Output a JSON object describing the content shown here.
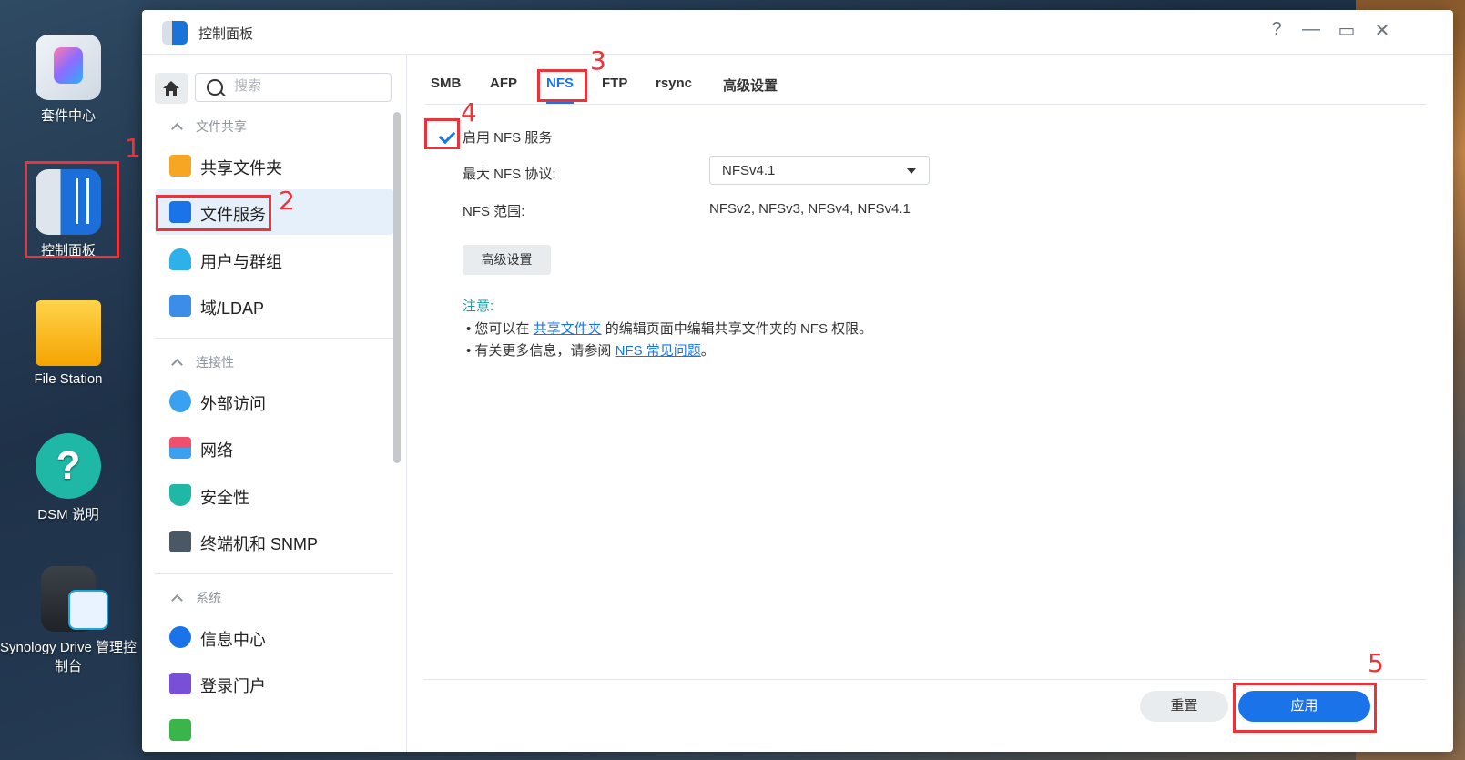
{
  "desktop": {
    "icons": [
      {
        "label": "套件中心"
      },
      {
        "label": "控制面板"
      },
      {
        "label": "File Station"
      },
      {
        "label": "DSM 说明"
      },
      {
        "label": "Synology Drive 管理控制台"
      }
    ]
  },
  "annotations": [
    "1",
    "2",
    "3",
    "4",
    "5"
  ],
  "window": {
    "title": "控制面板",
    "help_glyph": "?",
    "minimize_glyph": "—",
    "maximize_glyph": "▭",
    "close_glyph": "✕"
  },
  "sidebar": {
    "search_placeholder": "搜索",
    "sections": [
      {
        "title": "文件共享",
        "items": [
          {
            "label": "共享文件夹"
          },
          {
            "label": "文件服务"
          },
          {
            "label": "用户与群组"
          },
          {
            "label": "域/LDAP"
          }
        ]
      },
      {
        "title": "连接性",
        "items": [
          {
            "label": "外部访问"
          },
          {
            "label": "网络"
          },
          {
            "label": "安全性"
          },
          {
            "label": "终端机和 SNMP"
          }
        ]
      },
      {
        "title": "系统",
        "items": [
          {
            "label": "信息中心"
          },
          {
            "label": "登录门户"
          }
        ]
      }
    ]
  },
  "tabs": [
    "SMB",
    "AFP",
    "NFS",
    "FTP",
    "rsync",
    "高级设置"
  ],
  "nfs": {
    "enable_label": "启用 NFS 服务",
    "max_protocol_label": "最大 NFS 协议:",
    "max_protocol_value": "NFSv4.1",
    "range_label": "NFS 范围:",
    "range_value": "NFSv2, NFSv3, NFSv4, NFSv4.1",
    "advanced_button": "高级设置",
    "note_title": "注意:",
    "note1_pre": "您可以在 ",
    "note1_link": "共享文件夹",
    "note1_post": " 的编辑页面中编辑共享文件夹的 NFS 权限。",
    "note2_pre": "有关更多信息，请参阅 ",
    "note2_link": "NFS 常见问题",
    "note2_post": "。"
  },
  "footer": {
    "reset": "重置",
    "apply": "应用"
  }
}
